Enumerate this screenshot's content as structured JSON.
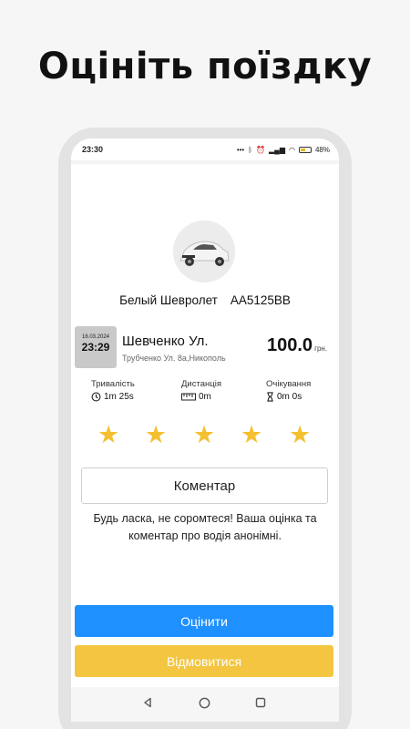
{
  "promo": {
    "title": "Оцініть поїздку"
  },
  "status_bar": {
    "time": "23:30",
    "battery": "48%"
  },
  "driver": {
    "car_model": "Белый Шевролет",
    "plate": "AA5125BB"
  },
  "trip": {
    "date": "16.03.2024",
    "time": "23:29",
    "street": "Шевченко Ул.",
    "address": "Трубченко Ул. 8а,Никополь",
    "price": "100.0",
    "currency": "грн."
  },
  "stats": {
    "duration": {
      "label": "Тривалість",
      "value": "1m 25s",
      "icon": "clock-icon"
    },
    "distance": {
      "label": "Дистанція",
      "value": "0m",
      "icon": "ruler-icon"
    },
    "waiting": {
      "label": "Очікування",
      "value": "0m 0s",
      "icon": "hourglass-icon"
    }
  },
  "rating": {
    "stars": 5,
    "max": 5,
    "color": "#f5c02f"
  },
  "comment": {
    "label": "Коментар"
  },
  "notice": "Будь ласка, не соромтеся! Ваша оцінка та коментар про водія анонімні.",
  "buttons": {
    "rate": "Оцінити",
    "decline": "Відмовитися",
    "rate_color": "#1e90ff",
    "decline_color": "#f3c540"
  }
}
